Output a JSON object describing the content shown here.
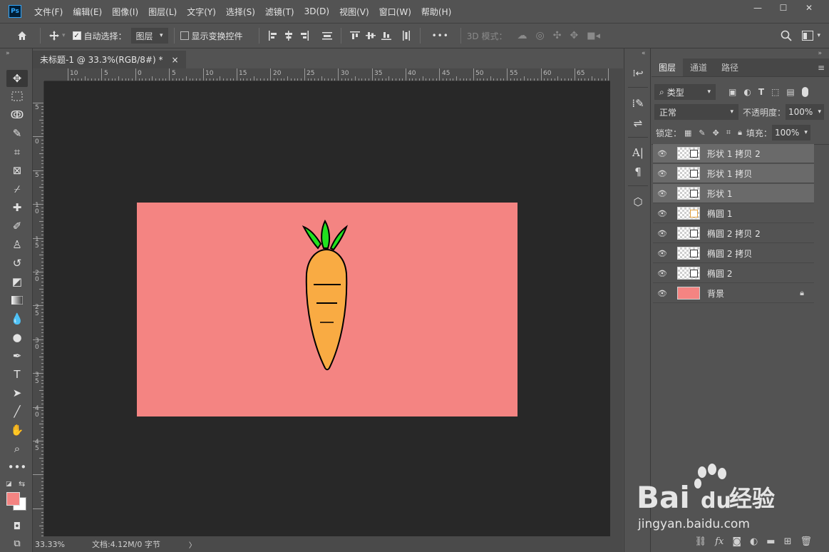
{
  "app": {
    "logo_text": "Ps"
  },
  "menu": [
    "文件(F)",
    "编辑(E)",
    "图像(I)",
    "图层(L)",
    "文字(Y)",
    "选择(S)",
    "滤镜(T)",
    "3D(D)",
    "视图(V)",
    "窗口(W)",
    "帮助(H)"
  ],
  "window_controls": {
    "minimize": "—",
    "maximize": "☐",
    "close": "✕"
  },
  "options": {
    "auto_select_label": "自动选择：",
    "auto_select_checked": true,
    "auto_select_target": "图层",
    "show_transform_label": "显示变换控件",
    "show_transform_checked": false,
    "more": "•••",
    "mode_3d_label": "3D 模式："
  },
  "document": {
    "tab_title": "未标题-1 @ 33.3%(RGB/8#) *",
    "tab_close": "×",
    "ruler_top_labels": [
      "10",
      "5",
      "0",
      "5",
      "10",
      "15",
      "20",
      "25",
      "30",
      "35",
      "40",
      "45",
      "50",
      "55",
      "60",
      "65"
    ],
    "ruler_left_labels": [
      "5",
      "0",
      "5",
      "1\n0",
      "1\n5",
      "2\n0",
      "2\n5",
      "3\n0",
      "3\n5",
      "4\n0",
      "4\n5"
    ],
    "background_color": "#f48482",
    "carrot_body_color": "#f9ab43",
    "carrot_leaf_color": "#22e11f"
  },
  "status": {
    "zoom": "33.33%",
    "doc_info": "文档:4.12M/0 字节",
    "arrow": "〉"
  },
  "layers_panel": {
    "tabs": [
      "图层",
      "通道",
      "路径"
    ],
    "filter_kind": "类型",
    "blend_mode": "正常",
    "opacity_label": "不透明度：",
    "opacity_value": "100%",
    "lock_label": "锁定：",
    "fill_label": "填充：",
    "fill_value": "100%",
    "layers": [
      {
        "name": "形状 1 拷贝 2",
        "selected": true
      },
      {
        "name": "形状 1 拷贝",
        "selected": true
      },
      {
        "name": "形状 1",
        "selected": true
      },
      {
        "name": "椭圆 1",
        "selected": false
      },
      {
        "name": "椭圆 2 拷贝 2",
        "selected": false
      },
      {
        "name": "椭圆 2 拷贝",
        "selected": false
      },
      {
        "name": "椭圆 2",
        "selected": false
      },
      {
        "name": "背景",
        "selected": false,
        "locked": true
      }
    ]
  },
  "watermark": {
    "brand": "Bai",
    "brand2": "du",
    "cn": "经验",
    "url": "jingyan.baidu.com"
  }
}
